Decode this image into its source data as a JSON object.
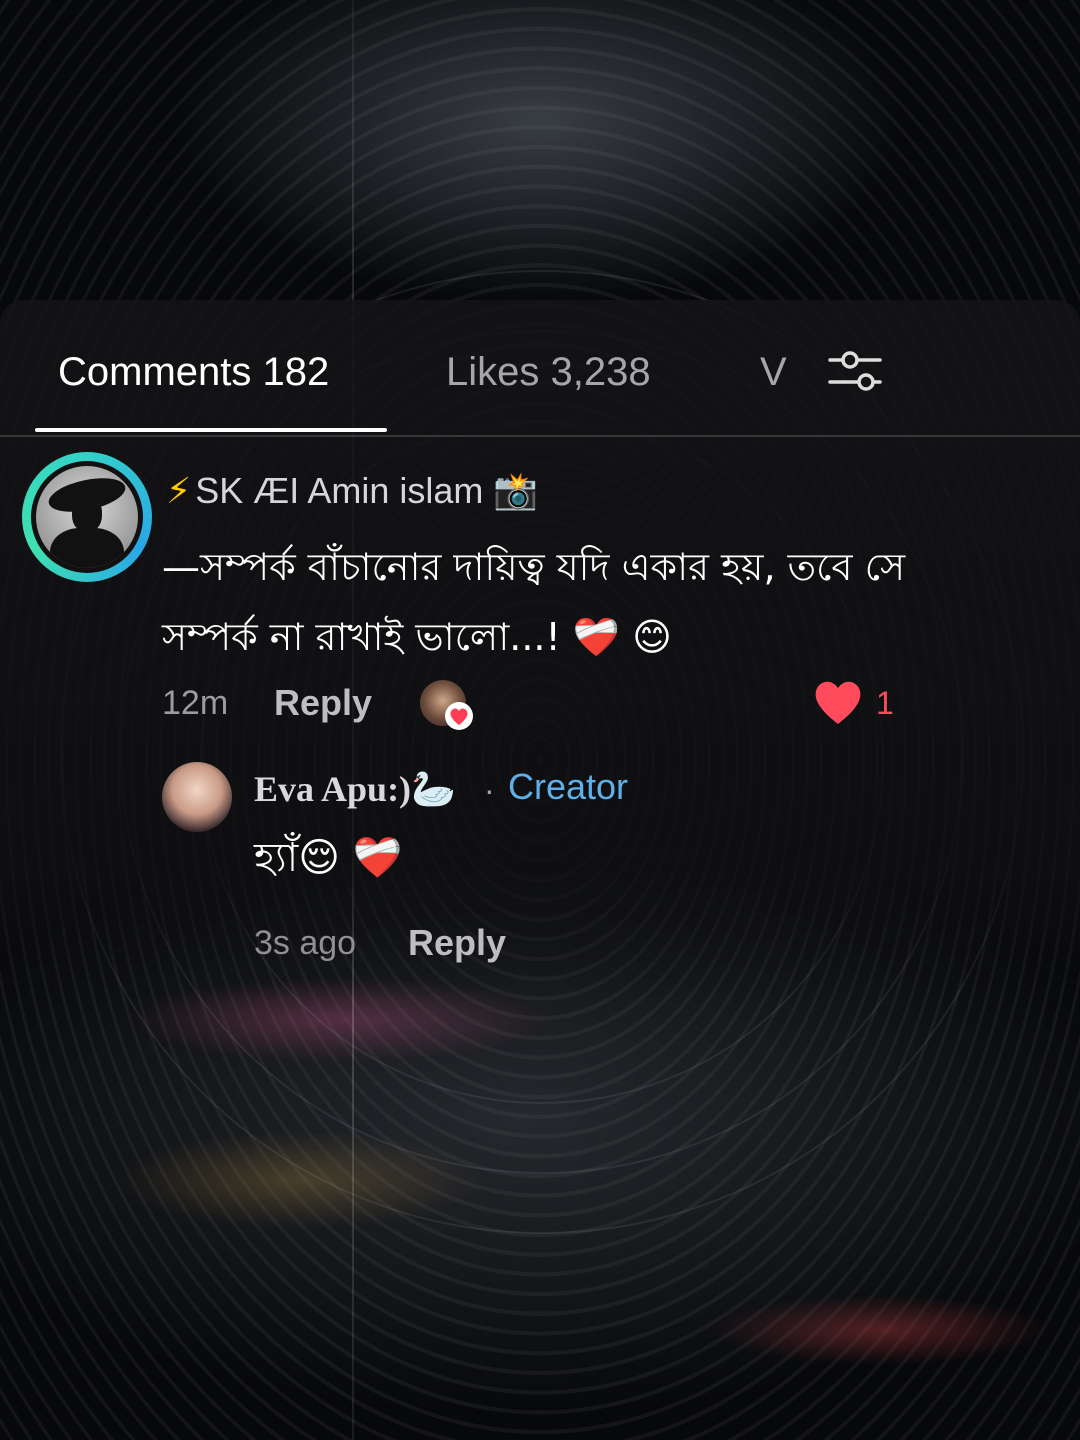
{
  "tabs": {
    "comments_label": "Comments 182",
    "likes_label": "Likes 3,238",
    "third_label": "V"
  },
  "icons": {
    "filter": "filter-sliders-icon",
    "like": "heart-icon",
    "badge": "camera-flash-emoji",
    "swan": "swan-emoji"
  },
  "comment": {
    "prefix": "⚡",
    "username": "SK ÆI Amin islam",
    "badge": "📸",
    "text": "—সম্পর্ক বাঁচানোর দায়িত্ব যদি একার হয়, তবে সে সম্পর্ক না রাখাই ভালো...! ❤️‍🩹 😊",
    "time": "12m",
    "reply_label": "Reply",
    "like_count": "1"
  },
  "reply": {
    "username": "Eva Apu:)🦢",
    "separator": "·",
    "creator_label": "Creator",
    "text": "হ্যাঁ😌 ❤️‍🩹",
    "time": "3s ago",
    "reply_label": "Reply"
  },
  "colors": {
    "accent_blue": "#5fb0e8",
    "like_red": "#ff4b5c",
    "avatar_ring": "#33d2c8"
  }
}
